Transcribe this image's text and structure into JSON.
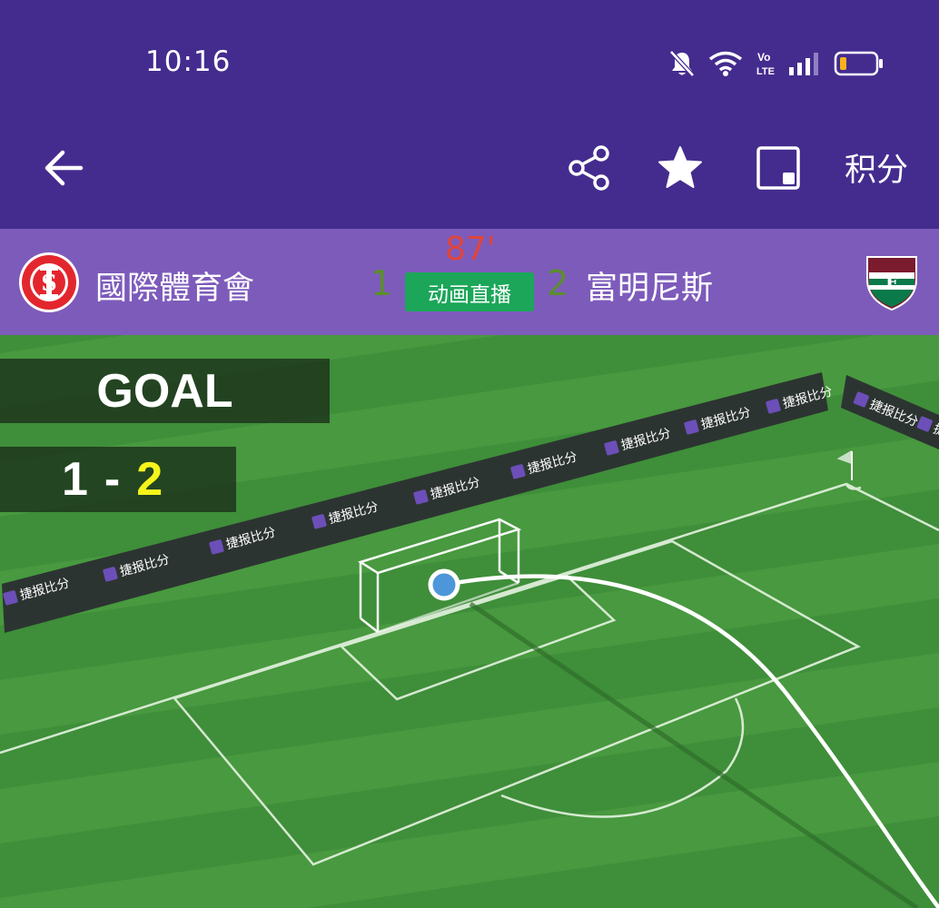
{
  "status": {
    "time": "10:16",
    "icons": [
      "mute-icon",
      "wifi-icon",
      "volte-icon",
      "signal-icon",
      "battery-icon"
    ],
    "volte_label": "Vo LTE"
  },
  "toolbar": {
    "back_icon": "back-arrow-icon",
    "share_icon": "share-icon",
    "favorite_icon": "star-icon",
    "pip_icon": "picture-in-picture-icon",
    "standings_label": "积分"
  },
  "match": {
    "home_team": "國際體育會",
    "away_team": "富明尼斯",
    "home_score": "1",
    "away_score": "2",
    "minute": "87'",
    "live_label": "动画直播",
    "home_crest_text": "S C INTERNACIONAL 1909",
    "away_crest_text": "FFC"
  },
  "overlay": {
    "event_title": "GOAL",
    "home_score": "1",
    "separator": "-",
    "away_score": "2"
  },
  "ad_board_text": "捷报比分",
  "colors": {
    "status_bar": "#442c8f",
    "match_bar": "#7d5bbb",
    "live_button": "#1ba659",
    "minute": "#e0453b",
    "score": "#5a8f2c",
    "pitch": "#3f8e3a",
    "away_highlight": "#f6f41c",
    "ball": "#4d96d9"
  }
}
